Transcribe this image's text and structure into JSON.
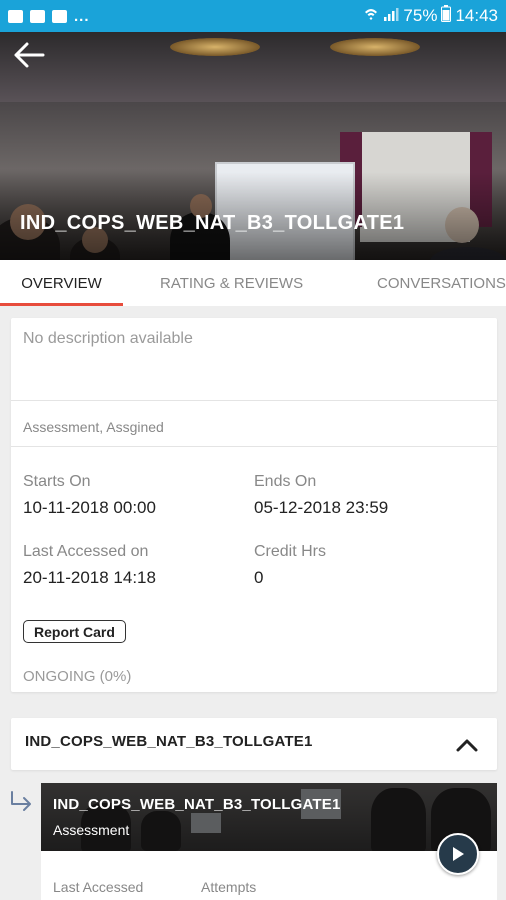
{
  "status_bar": {
    "battery_percent": "75%",
    "time": "14:43",
    "overflow": "..."
  },
  "course": {
    "title": "IND_COPS_WEB_NAT_B3_TOLLGATE1"
  },
  "tabs": [
    {
      "label": "OVERVIEW",
      "active": true
    },
    {
      "label": "RATING & REVIEWS",
      "active": false
    },
    {
      "label": "CONVERSATIONS",
      "active": false
    }
  ],
  "overview": {
    "description": "No description available",
    "tags": "Assessment, Assgined",
    "starts_on_label": "Starts On",
    "starts_on_value": "10-11-2018 00:00",
    "ends_on_label": "Ends On",
    "ends_on_value": "05-12-2018 23:59",
    "last_accessed_label": "Last Accessed on",
    "last_accessed_value": "20-11-2018 14:18",
    "credit_hrs_label": "Credit Hrs",
    "credit_hrs_value": "0",
    "report_card_label": "Report Card",
    "status": "ONGOING (0%)"
  },
  "module": {
    "title": "IND_COPS_WEB_NAT_B3_TOLLGATE1",
    "expanded": true
  },
  "item": {
    "title": "IND_COPS_WEB_NAT_B3_TOLLGATE1",
    "type": "Assessment",
    "last_accessed_label": "Last Accessed",
    "attempts_label": "Attempts"
  },
  "colors": {
    "status_bar": "#1aa3d9",
    "tab_indicator": "#e74c3c",
    "play_button": "#263a4a"
  }
}
